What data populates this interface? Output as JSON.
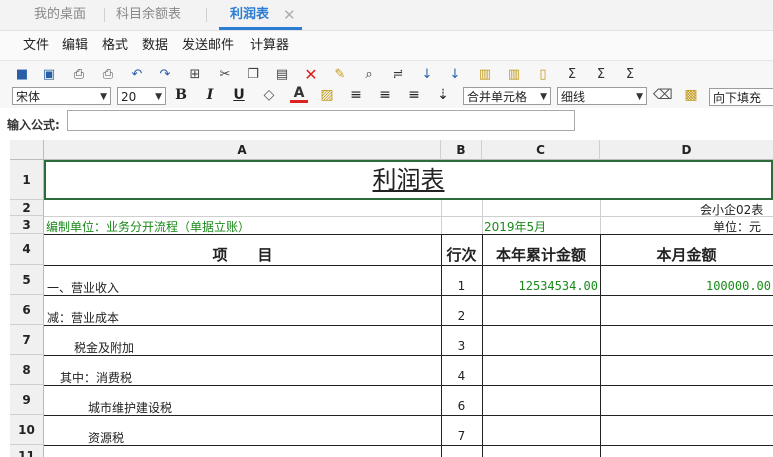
{
  "tabs": [
    {
      "label": "我的桌面"
    },
    {
      "label": "科目余额表"
    },
    {
      "label": "利润表",
      "active": true
    }
  ],
  "menu": [
    "文件",
    "编辑",
    "格式",
    "数据",
    "发送邮件",
    "计算器"
  ],
  "toolbar": {
    "font": "宋体",
    "size": "20",
    "merge": "合并单元格",
    "border": "细线",
    "fill": "向下填充"
  },
  "formula": {
    "label": "输入公式:",
    "value": ""
  },
  "columns": [
    "A",
    "B",
    "C",
    "D"
  ],
  "rows": [
    "1",
    "2",
    "3",
    "4",
    "5",
    "6",
    "7",
    "8",
    "9",
    "10",
    "11"
  ],
  "sheet": {
    "title": "利润表",
    "form_code": "会小企02表",
    "company": "编制单位：业务分开流程（单据立账）",
    "period": "2019年5月",
    "unit": "单位：元",
    "headers": {
      "item": "项　　目",
      "line": "行次",
      "ytd": "本年累计金额",
      "month": "本月金额"
    },
    "items": [
      {
        "name": "一、营业收入",
        "line": "1",
        "ytd": "12534534.00",
        "month": "100000.00"
      },
      {
        "name": "减：营业成本",
        "line": "2",
        "ytd": "",
        "month": ""
      },
      {
        "name": "税金及附加",
        "line": "3",
        "ytd": "",
        "month": ""
      },
      {
        "name": "其中：消费税",
        "line": "4",
        "ytd": "",
        "month": ""
      },
      {
        "name": "城市维护建设税",
        "line": "6",
        "ytd": "",
        "month": ""
      },
      {
        "name": "资源税",
        "line": "7",
        "ytd": "",
        "month": ""
      }
    ]
  },
  "colors": {
    "accent": "#2b7cd3",
    "value_green": "#1a8a1a",
    "selection": "#2e6b3a"
  }
}
